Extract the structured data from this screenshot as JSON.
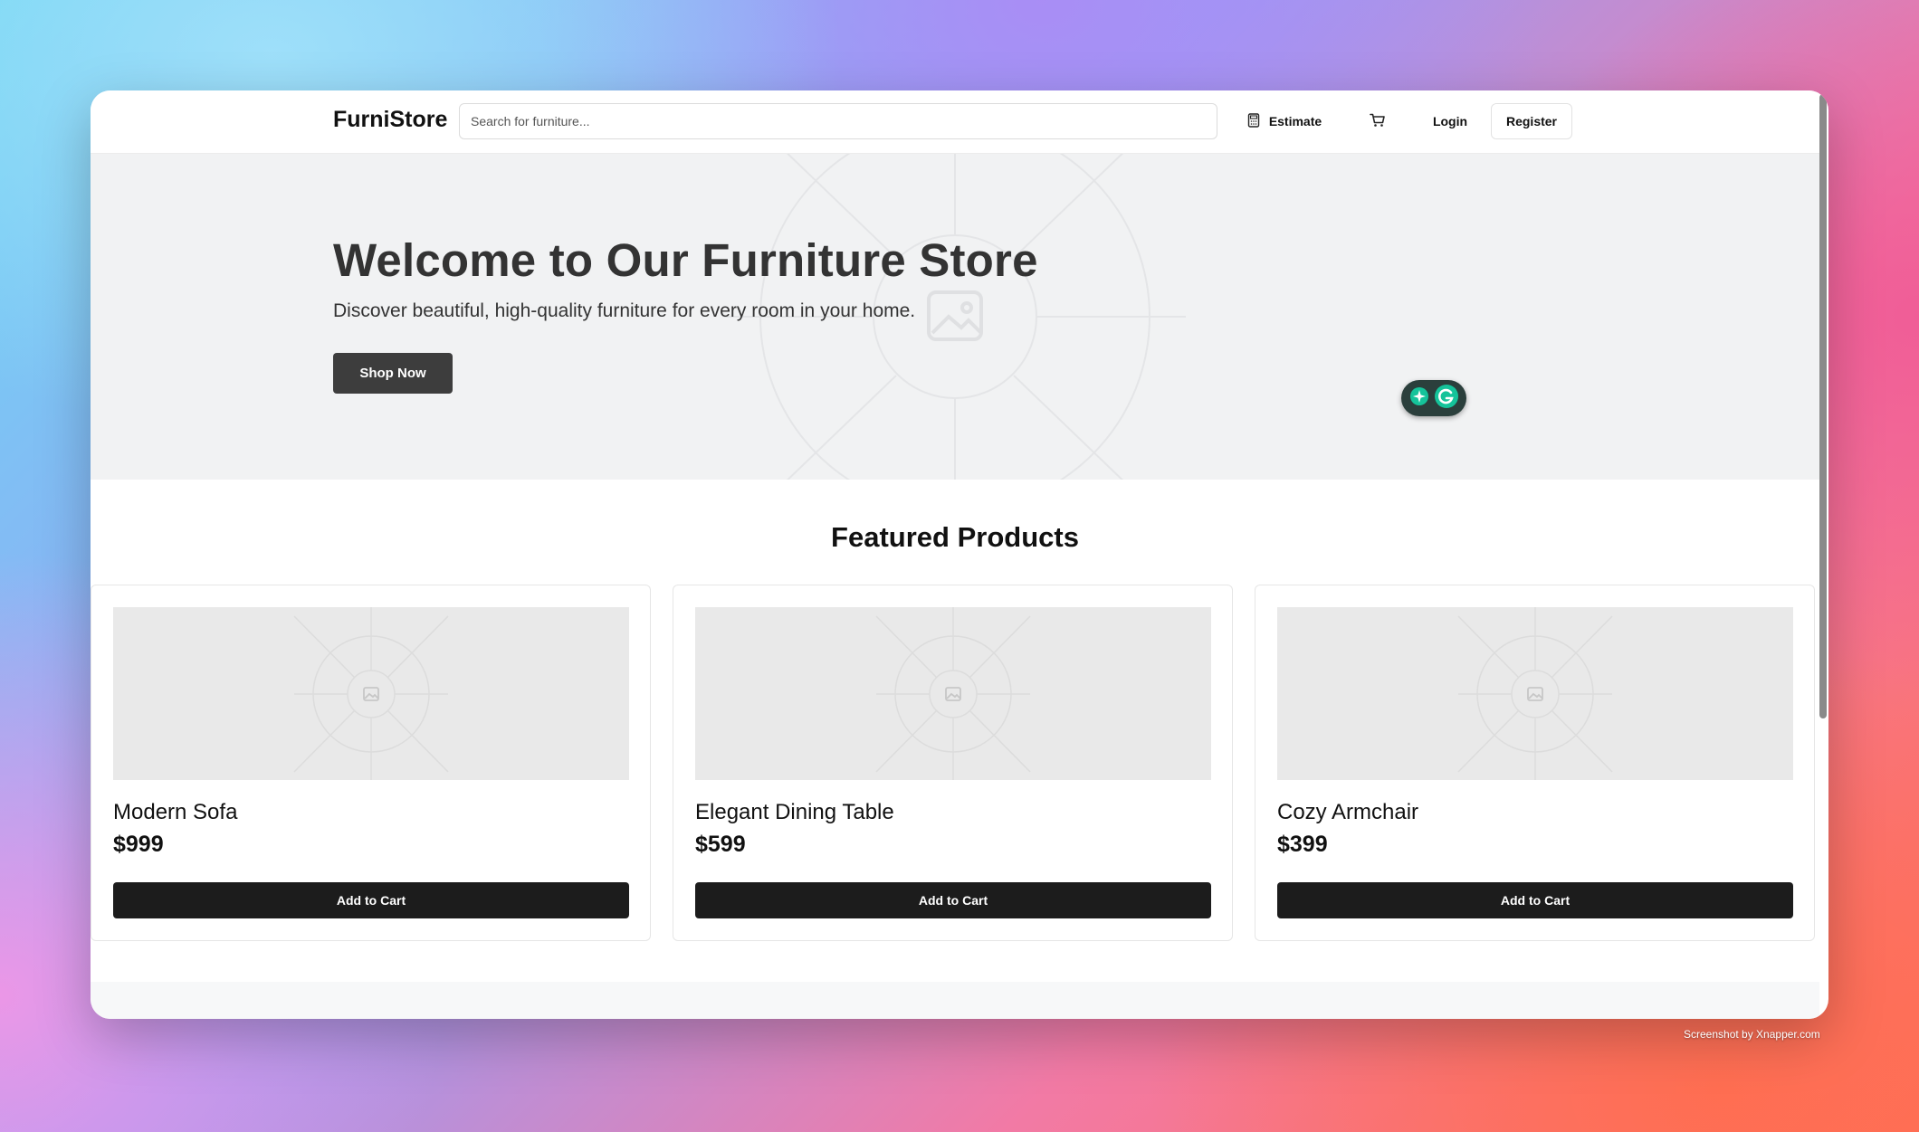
{
  "header": {
    "logo": "FurniStore",
    "search_placeholder": "Search for furniture...",
    "estimate_label": "Estimate",
    "login_label": "Login",
    "register_label": "Register"
  },
  "hero": {
    "title": "Welcome to Our Furniture Store",
    "subtitle": "Discover beautiful, high-quality furniture for every room in your home.",
    "button_label": "Shop Now"
  },
  "featured": {
    "title": "Featured Products",
    "products": [
      {
        "name": "Modern Sofa",
        "price": "$999",
        "button_label": "Add to Cart"
      },
      {
        "name": "Elegant Dining Table",
        "price": "$599",
        "button_label": "Add to Cart"
      },
      {
        "name": "Cozy Armchair",
        "price": "$399",
        "button_label": "Add to Cart"
      }
    ]
  },
  "watermark": "Screenshot by Xnapper.com",
  "icons": {
    "estimate": "calculator-icon",
    "cart": "cart-icon",
    "hero_placeholder": "image-placeholder-icon",
    "product_placeholder": "image-placeholder-icon",
    "grammarly": "grammarly-icon"
  },
  "colors": {
    "hero_bg": "#f1f2f3",
    "shop_button": "#3d3d3d",
    "cart_button": "#1c1c1c",
    "grammarly_green": "#15c39a"
  }
}
